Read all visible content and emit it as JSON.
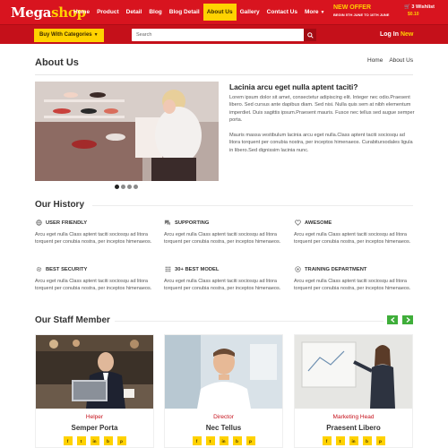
{
  "header": {
    "logo_main": "Mega",
    "logo_accent": "shop",
    "nav": [
      {
        "label": "Home"
      },
      {
        "label": "Product"
      },
      {
        "label": "Detail"
      },
      {
        "label": "Blog"
      },
      {
        "label": "Blog Detail"
      },
      {
        "label": "About Us",
        "active": true
      },
      {
        "label": "Gallery"
      },
      {
        "label": "Contact Us"
      },
      {
        "label": "More"
      }
    ],
    "offer_title": "NEW OFFER",
    "offer_subtitle": "BEGIN 5TH JUNE TO 10TH JUNE",
    "wishlist_label": "3 Wishlist",
    "wishlist_price": "$0.10",
    "brand_color": "#d8141f",
    "accent_color": "#ffd200"
  },
  "subbar": {
    "categories_label": "Buy With Categories",
    "search_placeholder": "Search",
    "login_label": "Log In",
    "new_label": "New"
  },
  "page": {
    "title": "About Us",
    "breadcrumb": [
      "Home",
      "About Us"
    ]
  },
  "about": {
    "heading": "Lacinia arcu eget nulla aptent taciti?",
    "p1": "Lorem ipsum dolor sit amet, consectetur adipiscing elit. Integer nec odio.Praesent libero. Sed cursus ante dapibus diam. Sed nisi. Nulla quis sem at nibh elementum imperdiet. Duis sagittis ipsum.Praesent mauris. Fusce nec tellus sed augue semper porta.",
    "p2": "Mauris massa vestibulum lacinia arcu eget nulla.Class aptent taciti sociosqu ad litora torquent per conubia nostra, per inceptos himenaeos. Curabitursodales ligula in libero.Sed dignissim lacinia nunc.",
    "slider_dots": 4,
    "active_dot": 0
  },
  "history": {
    "title": "Our History",
    "items": [
      {
        "icon": "globe-icon",
        "title": "USER FRIENDLY",
        "text": "Arcu eget nulla Class aptent taciti sociosqu ad litora torquent per conubia nostra, per inceptos himenaeos."
      },
      {
        "icon": "chat-icon",
        "title": "SUPPORTING",
        "text": "Arcu eget nulla Class aptent taciti sociosqu ad litora torquent per conubia nostra, per inceptos himenaeos."
      },
      {
        "icon": "heart-icon",
        "title": "AWESOME",
        "text": "Arcu eget nulla Class aptent taciti sociosqu ad litora torquent per conubia nostra, per inceptos himenaeos."
      },
      {
        "icon": "gear-icon",
        "title": "BEST SECURITY",
        "text": "Arcu eget nulla Class aptent taciti sociosqu ad litora torquent per conubia nostra, per inceptos himenaeos."
      },
      {
        "icon": "grid-icon",
        "title": "30+ BEST MODEL",
        "text": "Arcu eget nulla Class aptent taciti sociosqu ad litora torquent per conubia nostra, per inceptos himenaeos."
      },
      {
        "icon": "target-icon",
        "title": "TRAINING DEPARTMENT",
        "text": "Arcu eget nulla Class aptent taciti sociosqu ad litora torquent per conubia nostra, per inceptos himenaeos."
      }
    ]
  },
  "staff": {
    "title": "Our Staff Member",
    "members": [
      {
        "role": "Helper",
        "name": "Semper Porta"
      },
      {
        "role": "Director",
        "name": "Nec Tellus"
      },
      {
        "role": "Marketing Head",
        "name": "Praesent Libero"
      }
    ],
    "social_icons": [
      "f",
      "t",
      "in",
      "b",
      "p"
    ],
    "arrow_color": "#3fae3a"
  }
}
